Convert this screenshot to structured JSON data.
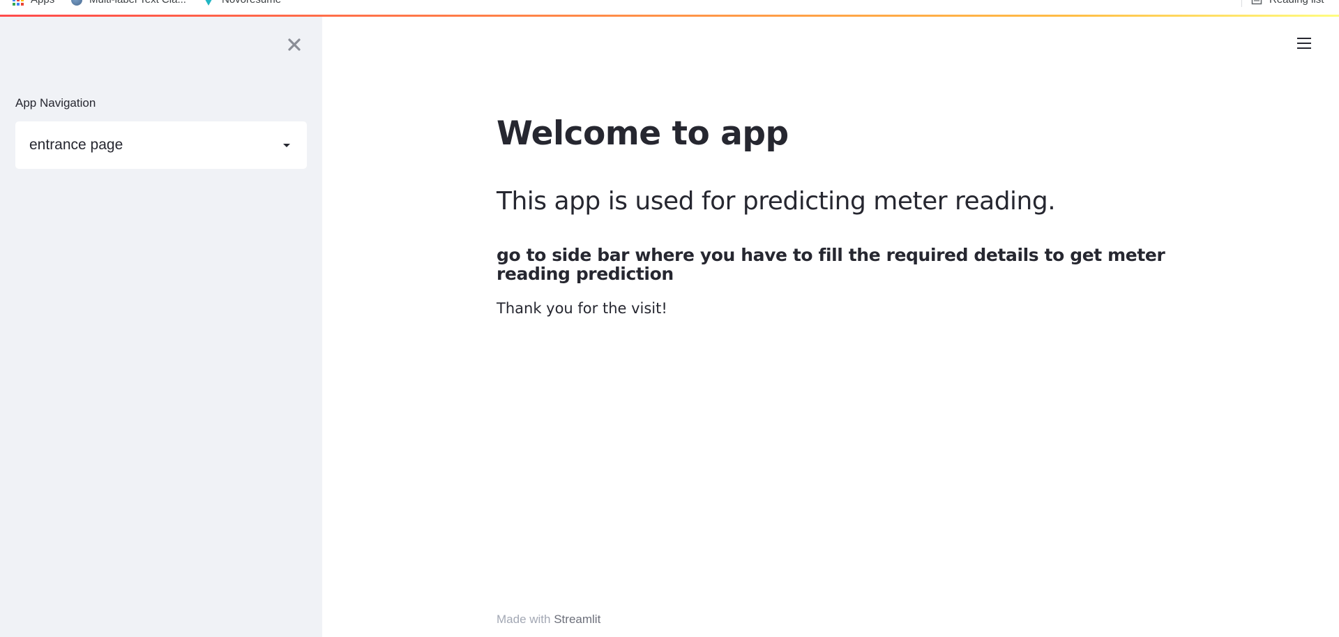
{
  "browser": {
    "bookmarks": [
      {
        "label": "Apps",
        "icon": "apps-grid-icon"
      },
      {
        "label": "Multi-label Text Cla...",
        "icon": "globe-icon"
      },
      {
        "label": "Novoresume",
        "icon": "novoresume-icon"
      }
    ],
    "reading_list": {
      "label": "Reading list",
      "icon": "reading-list-icon"
    }
  },
  "decoration": {
    "colors": [
      "#ff4b4b",
      "#ffbd45",
      "#fffd80"
    ]
  },
  "sidebar": {
    "background": "#f0f2f6",
    "close_icon": "close-icon",
    "nav_label": "App Navigation",
    "select": {
      "value": "entrance page",
      "icon": "chevron-down-icon"
    }
  },
  "header": {
    "menu_icon": "hamburger-menu-icon"
  },
  "main": {
    "title": "Welcome to app",
    "subtitle": "This app is used for predicting meter reading.",
    "instructions": "go to side bar where you have to fill the required details to get meter reading prediction",
    "thanks": "Thank you for the visit!"
  },
  "footer": {
    "prefix": "Made with",
    "link": "Streamlit"
  },
  "colors": {
    "text": "#262730",
    "footer_text": "#a3a8b4",
    "footer_link": "#6c6f7a",
    "sidebar_bg": "#f0f2f6"
  }
}
